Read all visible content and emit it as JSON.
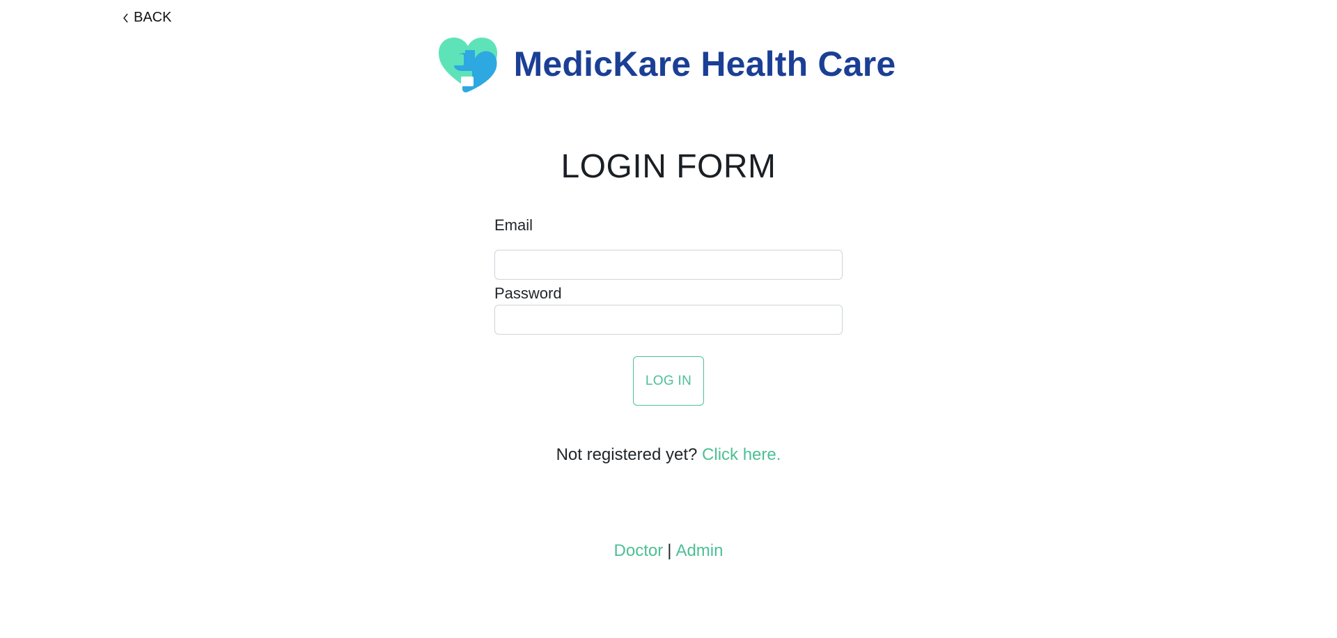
{
  "nav": {
    "back_label": "BACK"
  },
  "brand": {
    "name": "MedicKare Health Care",
    "logo_icon": "heart-cross-logo",
    "colors": {
      "name": "#1b3f95",
      "logo_back": "#5ee3b8",
      "logo_front": "#2ea8e0"
    }
  },
  "form": {
    "title": "LOGIN FORM",
    "email_label": "Email",
    "email_value": "",
    "password_label": "Password",
    "password_value": "",
    "submit_label": "LOG IN"
  },
  "register": {
    "prompt": "Not registered yet?",
    "link_label": "Click here."
  },
  "footer": {
    "doctor_label": "Doctor",
    "separator": "|",
    "admin_label": "Admin"
  },
  "colors": {
    "accent": "#4cbf95",
    "text": "#212529"
  }
}
